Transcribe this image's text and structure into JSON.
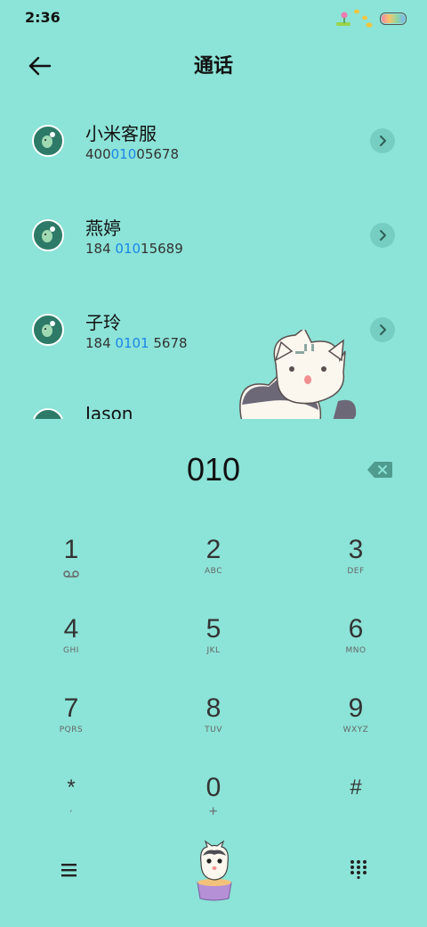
{
  "status_bar": {
    "time": "2:36"
  },
  "header": {
    "title": "通话"
  },
  "results": [
    {
      "name": "小米客服",
      "number_parts": [
        "400",
        "010",
        "05678"
      ]
    },
    {
      "name": "燕婷",
      "number_parts": [
        "184 ",
        "010",
        "15689"
      ]
    },
    {
      "name": "子玲",
      "number_parts": [
        "184 ",
        "0101",
        " 5678"
      ]
    },
    {
      "name": "Jason",
      "number_parts": [
        "",
        "",
        ""
      ]
    }
  ],
  "dialer": {
    "number": "010"
  },
  "keypad": [
    {
      "digit": "1",
      "letters": ""
    },
    {
      "digit": "2",
      "letters": "ABC"
    },
    {
      "digit": "3",
      "letters": "DEF"
    },
    {
      "digit": "4",
      "letters": "GHI"
    },
    {
      "digit": "5",
      "letters": "JKL"
    },
    {
      "digit": "6",
      "letters": "MNO"
    },
    {
      "digit": "7",
      "letters": "PQRS"
    },
    {
      "digit": "8",
      "letters": "TUV"
    },
    {
      "digit": "9",
      "letters": "WXYZ"
    },
    {
      "digit": "*",
      "letters": ","
    },
    {
      "digit": "0",
      "letters": "+"
    },
    {
      "digit": "#",
      "letters": ""
    }
  ],
  "icons": {
    "back": "arrow-left-icon",
    "chevron": "chevron-right-icon",
    "backspace": "backspace-icon",
    "voicemail": "voicemail-icon",
    "menu": "menu-icon",
    "dialpad": "dialpad-icon",
    "call": "cat-call-button"
  },
  "colors": {
    "background": "#8ce3d7",
    "highlight": "#1a86e8",
    "avatar": "#2c7a67"
  }
}
